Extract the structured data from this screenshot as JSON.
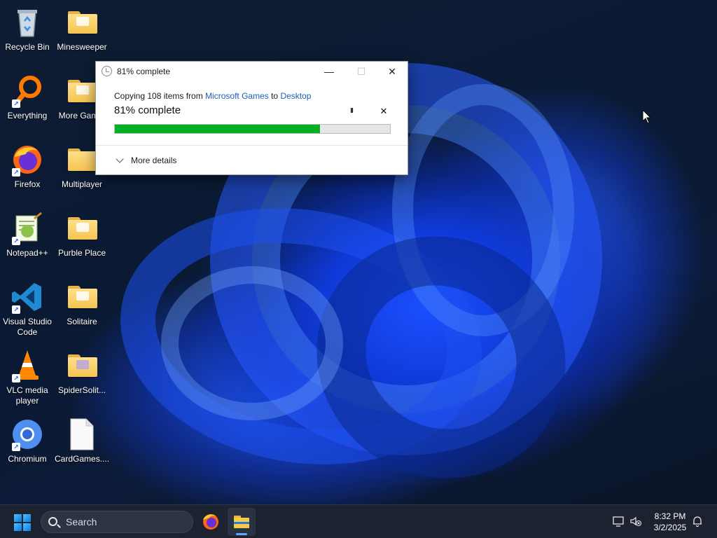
{
  "desktop": {
    "icons": [
      {
        "label": "Recycle Bin"
      },
      {
        "label": "Minesweeper"
      },
      {
        "label": "Everything"
      },
      {
        "label": "More Gam..."
      },
      {
        "label": "Firefox"
      },
      {
        "label": "Multiplayer"
      },
      {
        "label": "Notepad++"
      },
      {
        "label": "Purble Place"
      },
      {
        "label": "Visual Studio Code"
      },
      {
        "label": "Solitaire"
      },
      {
        "label": "VLC media player"
      },
      {
        "label": "SpiderSolit..."
      },
      {
        "label": "Chromium"
      },
      {
        "label": "CardGames...."
      }
    ]
  },
  "dialog": {
    "title": "81% complete",
    "copy_prefix": "Copying 108 items from ",
    "source": "Microsoft Games",
    "copy_mid": " to ",
    "destination": "Desktop",
    "percent_text": "81% complete",
    "progress_fraction": 0.745,
    "more_details": "More details",
    "minimize_glyph": "—",
    "maximize_glyph": "☐",
    "close_glyph": "✕",
    "pause_glyph": "II",
    "stop_glyph": "✕"
  },
  "taskbar": {
    "search_placeholder": "Search",
    "time": "8:32 PM",
    "date": "3/2/2025"
  },
  "colors": {
    "progress_fill": "#06b025",
    "link": "#1a5fb4",
    "taskbar_bg": "#1c2230"
  }
}
